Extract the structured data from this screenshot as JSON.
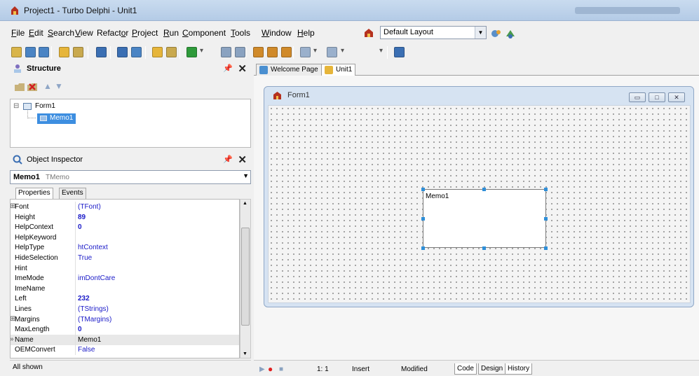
{
  "window": {
    "title": "Project1 - Turbo Delphi - Unit1"
  },
  "menu": {
    "items": [
      {
        "hot": "F",
        "rest": "ile"
      },
      {
        "hot": "E",
        "rest": "dit"
      },
      {
        "hot": "S",
        "rest": "earch"
      },
      {
        "hot": "V",
        "rest": "iew"
      },
      {
        "pre": "Refact",
        "hot": "o",
        "rest": "r"
      },
      {
        "hot": "P",
        "rest": "roject"
      },
      {
        "hot": "R",
        "rest": "un"
      },
      {
        "hot": "C",
        "rest": "omponent"
      },
      {
        "hot": "T",
        "rest": "ools"
      },
      {
        "hot": "W",
        "rest": "indow"
      },
      {
        "hot": "H",
        "rest": "elp"
      }
    ],
    "layout_select": "Default Layout"
  },
  "structure": {
    "title": "Structure",
    "tree": [
      {
        "label": "Form1",
        "expander": "⊟"
      },
      {
        "label": "Memo1",
        "selected": true
      }
    ]
  },
  "object_inspector": {
    "title": "Object Inspector",
    "selected_name": "Memo1",
    "selected_type": "TMemo",
    "tabs": [
      "Properties",
      "Events"
    ],
    "properties": [
      {
        "prefix": "⊞",
        "name": "Font",
        "value": "(TFont)"
      },
      {
        "name": "Height",
        "value": "89",
        "bold": true
      },
      {
        "name": "HelpContext",
        "value": "0",
        "bold": true
      },
      {
        "name": "HelpKeyword",
        "value": ""
      },
      {
        "name": "HelpType",
        "value": "htContext"
      },
      {
        "name": "HideSelection",
        "value": "True"
      },
      {
        "name": "Hint",
        "value": ""
      },
      {
        "name": "ImeMode",
        "value": "imDontCare"
      },
      {
        "name": "ImeName",
        "value": ""
      },
      {
        "name": "Left",
        "value": "232",
        "bold": true
      },
      {
        "name": "Lines",
        "value": "(TStrings)"
      },
      {
        "prefix": "⊞",
        "name": "Margins",
        "value": "(TMargins)"
      },
      {
        "name": "MaxLength",
        "value": "0",
        "bold": true
      },
      {
        "prefix": "»",
        "name": "Name",
        "value": "Memo1",
        "selected": true
      },
      {
        "name": "OEMConvert",
        "value": "False"
      }
    ],
    "status": "All shown"
  },
  "editor": {
    "tabs": [
      {
        "label": "Welcome Page",
        "active": false
      },
      {
        "label": "Unit1",
        "active": true
      }
    ],
    "form_title": "Form1",
    "memo_text": "Memo1",
    "window_buttons": [
      "▭",
      "□",
      "✕"
    ]
  },
  "statusbar": {
    "position": "1:  1",
    "mode": "Insert",
    "state": "Modified",
    "view_tabs": [
      "Code",
      "Design",
      "History"
    ]
  },
  "colors": {
    "title_gradient_top": "#c9dbef",
    "value_blue": "#1a1ac8",
    "handle_blue": "#2f8fd8",
    "selection_blue": "#3d8ee0"
  }
}
